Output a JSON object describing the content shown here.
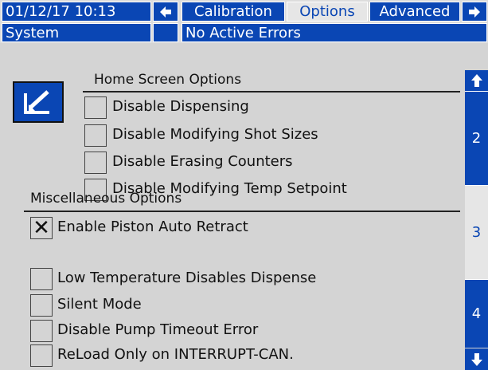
{
  "header": {
    "datetime": "01/12/17 10:13",
    "tabs": [
      {
        "label": "Calibration"
      },
      {
        "label": "Options",
        "active": true
      },
      {
        "label": "Advanced"
      }
    ],
    "status_left": "System",
    "status_message": "No Active Errors"
  },
  "home_screen": {
    "title": "Home Screen Options",
    "options": [
      {
        "label": "Disable Dispensing",
        "checked": false
      },
      {
        "label": "Disable Modifying Shot Sizes",
        "checked": false
      },
      {
        "label": "Disable Erasing Counters",
        "checked": false
      },
      {
        "label": "Disable Modifying Temp Setpoint",
        "checked": false
      }
    ]
  },
  "misc": {
    "title": "Miscellaneous Options",
    "options": [
      {
        "label": "Enable Piston Auto Retract",
        "checked": true
      },
      {
        "label": "Low Temperature Disables Dispense",
        "checked": false
      },
      {
        "label": "Silent Mode",
        "checked": false
      },
      {
        "label": "Disable Pump Timeout Error",
        "checked": false
      },
      {
        "label": "ReLoad Only on INTERRUPT-CAN.",
        "checked": false
      }
    ]
  },
  "pager": {
    "pages": [
      "2",
      "3",
      "4"
    ],
    "active_page": "3"
  },
  "icons": {
    "left_arrow": "left-arrow-icon",
    "right_arrow": "right-arrow-icon",
    "up_arrow": "up-arrow-icon",
    "down_arrow": "down-arrow-icon",
    "edit": "edit-icon",
    "check_mark": "✕"
  },
  "colors": {
    "accent": "#0a46b4",
    "background": "#d4d4d4",
    "active_tab": "#e6e6e6"
  }
}
